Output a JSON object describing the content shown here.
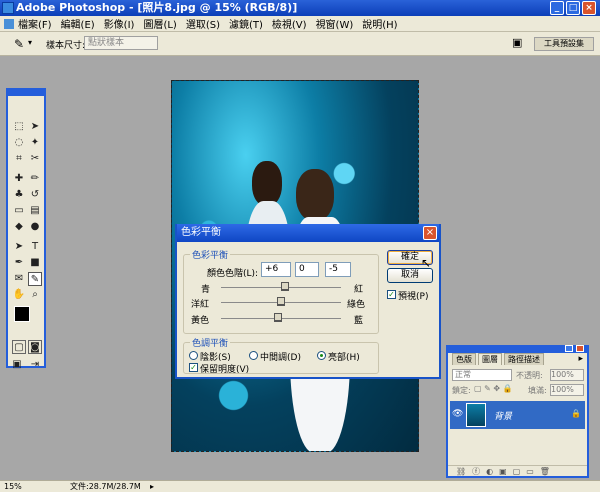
{
  "window": {
    "title": "Adobe Photoshop - [照片8.jpg @ 15% (RGB/8)]"
  },
  "menu": [
    "檔案(F)",
    "編輯(E)",
    "影像(I)",
    "圖層(L)",
    "選取(S)",
    "濾鏡(T)",
    "檢視(V)",
    "視窗(W)",
    "說明(H)"
  ],
  "options": {
    "sample_label": "樣本尺寸:",
    "sample_value": "點狀樣本",
    "palette_well": "工具預設集"
  },
  "dialog": {
    "title": "色彩平衡",
    "balance_group": "色彩平衡",
    "levels_label": "顏色色階(L):",
    "levels": [
      "+6",
      "0",
      "-5"
    ],
    "sliders": [
      {
        "left": "青",
        "right": "紅",
        "value": 6
      },
      {
        "left": "洋紅",
        "right": "綠色",
        "value": 0
      },
      {
        "left": "黃色",
        "right": "藍",
        "value": -5
      }
    ],
    "tone_group": "色調平衡",
    "tones": [
      "陰影(S)",
      "中間調(D)",
      "亮部(H)"
    ],
    "tone_selected": 2,
    "preserve_label": "保留明度(V)",
    "ok": "確定",
    "cancel": "取消",
    "preview": "預視(P)"
  },
  "layers": {
    "tabs": [
      "色版",
      "圖層",
      "路徑描述"
    ],
    "blend_mode": "正常",
    "opacity_label": "不透明:",
    "opacity_value": "100%",
    "lock_label": "鎖定:",
    "fill_label": "填滿:",
    "fill_value": "100%",
    "layer_name": "背景"
  },
  "status": {
    "zoom": "15%",
    "doc": "文件:28.7M/28.7M"
  },
  "colors": {
    "accent": "#245edb",
    "dialog_bg": "#ece9d8",
    "photo_tint": "#0d7ea6"
  }
}
